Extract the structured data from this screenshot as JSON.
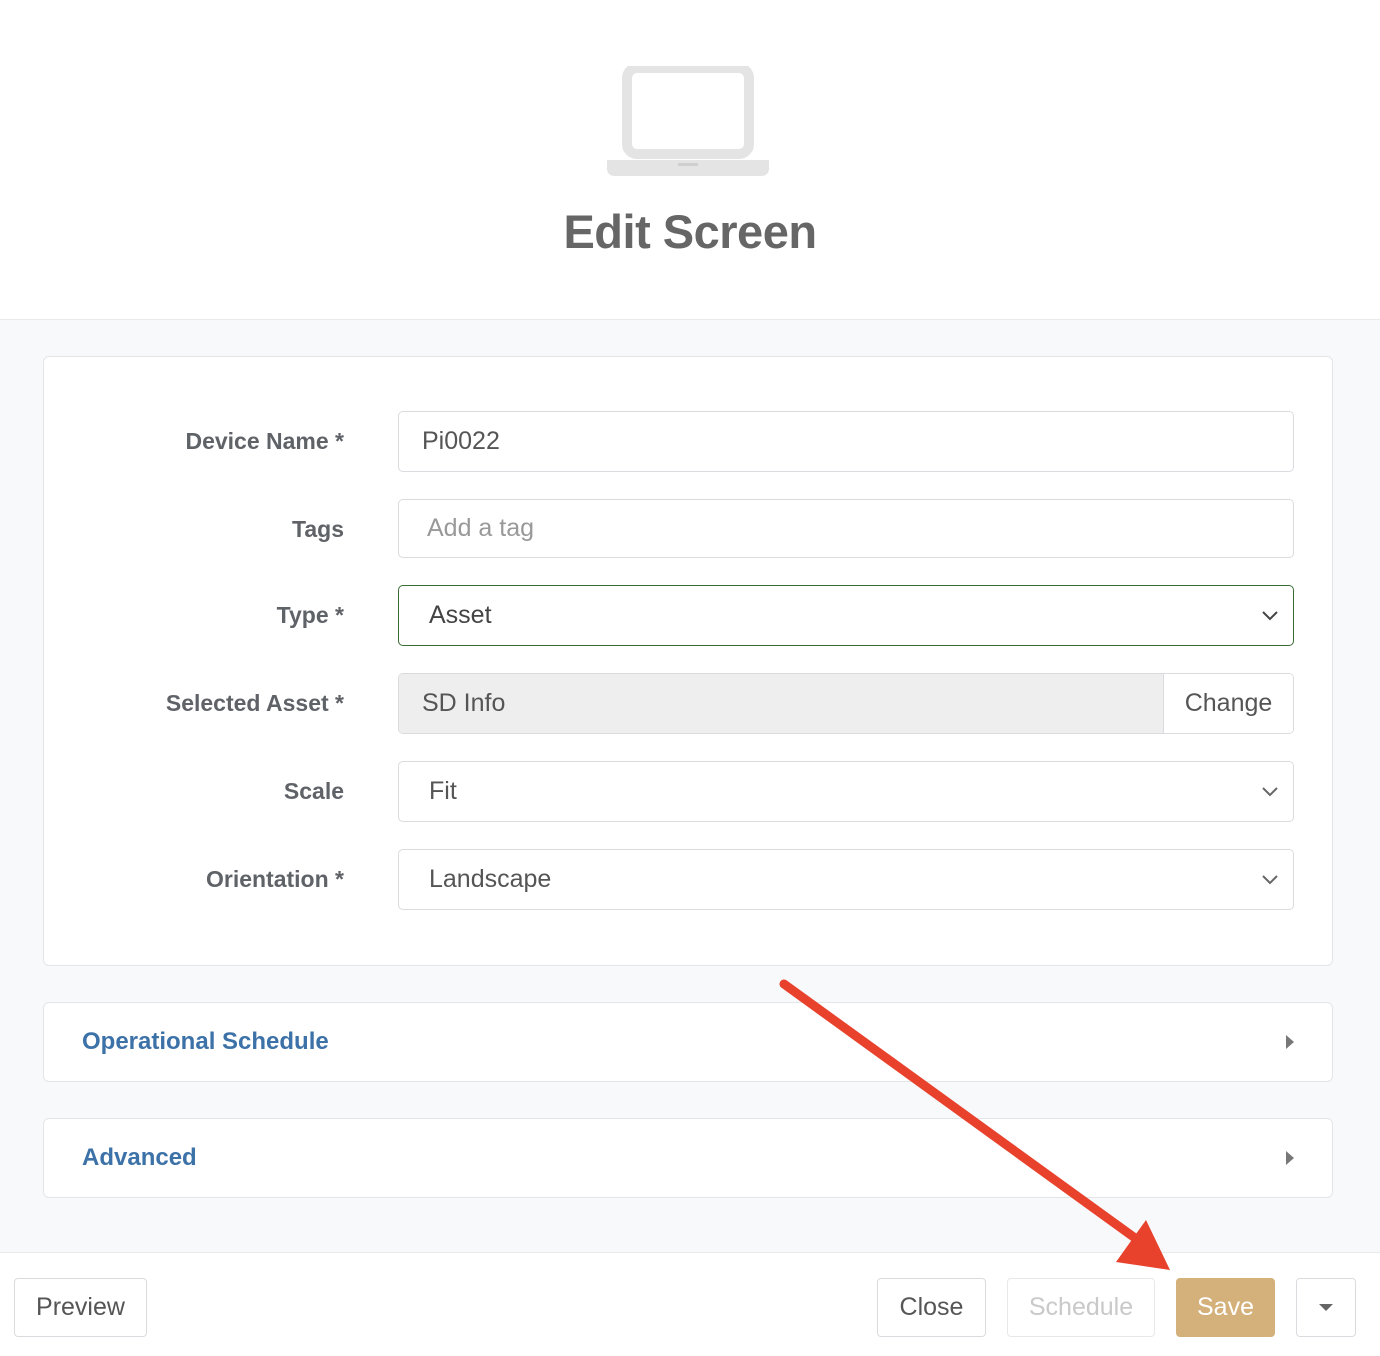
{
  "header": {
    "icon": "laptop-icon",
    "title": "Edit Screen"
  },
  "form": {
    "device_name": {
      "label": "Device Name *",
      "value": "Pi0022"
    },
    "tags": {
      "label": "Tags",
      "placeholder": "Add a tag"
    },
    "type": {
      "label": "Type *",
      "value": "Asset"
    },
    "selected_asset": {
      "label": "Selected Asset *",
      "value": "SD Info",
      "change_label": "Change"
    },
    "scale": {
      "label": "Scale",
      "value": "Fit"
    },
    "orientation": {
      "label": "Orientation *",
      "value": "Landscape"
    }
  },
  "sections": {
    "operational_schedule": "Operational Schedule",
    "advanced": "Advanced"
  },
  "footer": {
    "preview": "Preview",
    "close": "Close",
    "schedule": "Schedule",
    "save": "Save"
  },
  "colors": {
    "accent_link": "#3d72a8",
    "save_button": "#d4b07a",
    "annotation_arrow": "#e8412c",
    "focused_border": "#3a6b35"
  }
}
